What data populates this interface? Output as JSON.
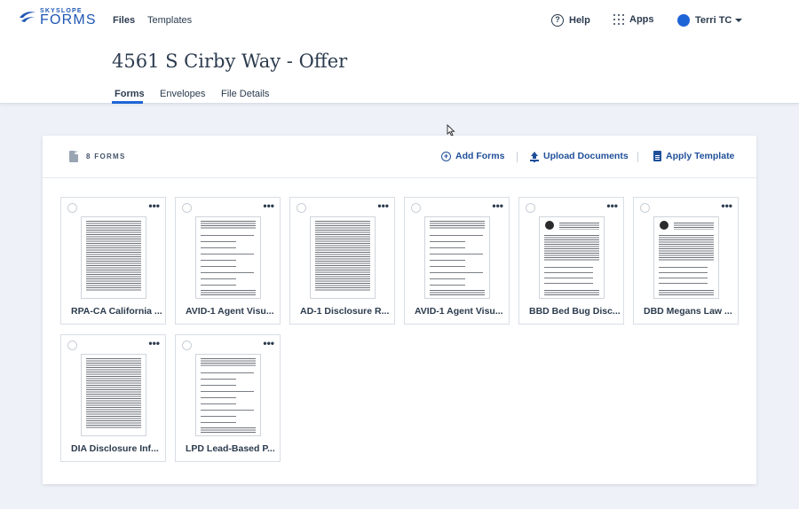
{
  "brand": {
    "small": "SKYSLOPE",
    "big": "FORMS",
    "color": "#1f57b4"
  },
  "nav": {
    "files": "Files",
    "templates": "Templates"
  },
  "right": {
    "help": "Help",
    "apps": "Apps",
    "user": "Terri TC"
  },
  "page": {
    "title": "4561 S Cirby Way - Offer"
  },
  "tabs": {
    "forms": "Forms",
    "envelopes": "Envelopes",
    "file_details": "File Details"
  },
  "panel": {
    "count_label": "8 FORMS",
    "add_forms": "Add Forms",
    "upload_documents": "Upload Documents",
    "apply_template": "Apply Template"
  },
  "forms": [
    {
      "label": "RPA-CA California ...",
      "style": "dense"
    },
    {
      "label": "AVID-1 Agent Visu...",
      "style": "form"
    },
    {
      "label": "AD-1 Disclosure R...",
      "style": "dense"
    },
    {
      "label": "AVID-1 Agent Visu...",
      "style": "form"
    },
    {
      "label": "BBD Bed Bug Disc...",
      "style": "logo"
    },
    {
      "label": "DBD Megans Law ...",
      "style": "logo"
    },
    {
      "label": "DIA Disclosure Inf...",
      "style": "dense"
    },
    {
      "label": "LPD Lead-Based P...",
      "style": "form"
    }
  ],
  "colors": {
    "accent": "#1f64d6",
    "link": "#1f4f99",
    "background": "#eef2f8"
  }
}
